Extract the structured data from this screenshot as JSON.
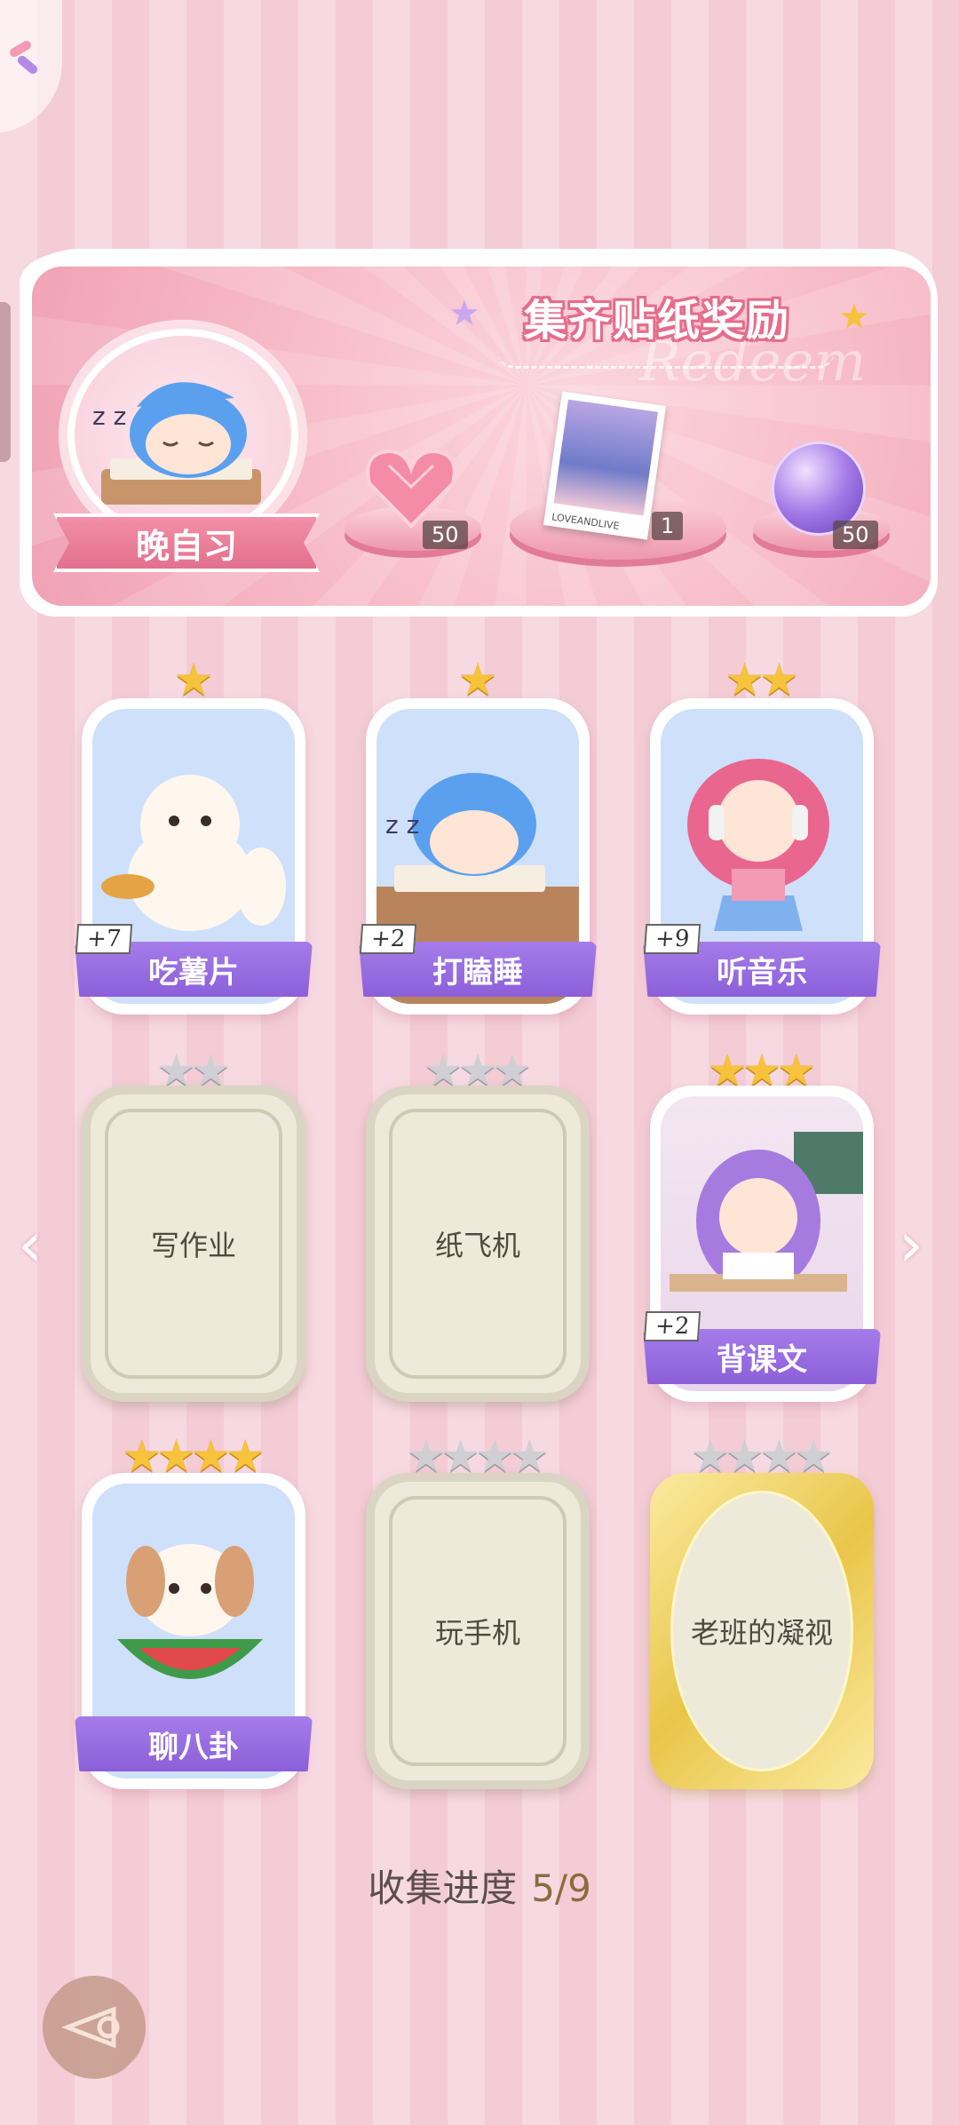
{
  "banner": {
    "title": "集齐贴纸奖励",
    "watermark": "Redeem",
    "theme_label": "晚自习",
    "rewards": [
      {
        "icon": "heart-gem-icon",
        "count": "50"
      },
      {
        "icon": "photo-card-icon",
        "count": "1",
        "caption": "LOVEANDLIVE"
      },
      {
        "icon": "purple-orb-icon",
        "count": "50"
      }
    ]
  },
  "stickers": [
    {
      "name": "吃薯片",
      "stars": 1,
      "collected": true,
      "plus": "+7"
    },
    {
      "name": "打瞌睡",
      "stars": 1,
      "collected": true,
      "plus": "+2"
    },
    {
      "name": "听音乐",
      "stars": 2,
      "collected": true,
      "plus": "+9"
    },
    {
      "name": "写作业",
      "stars": 2,
      "collected": false
    },
    {
      "name": "纸飞机",
      "stars": 3,
      "collected": false
    },
    {
      "name": "背课文",
      "stars": 3,
      "collected": true,
      "plus": "+2"
    },
    {
      "name": "聊八卦",
      "stars": 4,
      "collected": true
    },
    {
      "name": "玩手机",
      "stars": 4,
      "collected": false
    },
    {
      "name": "老班的凝视",
      "stars": 4,
      "collected": false,
      "golden": true
    }
  ],
  "progress": {
    "label": "收集进度",
    "value": "5/9"
  },
  "nav": {
    "prev": "‹",
    "next": "›"
  },
  "colors": {
    "accent_pink": "#e56d8c",
    "name_bar_purple": "#9a6fe2",
    "star_gold": "#f7c23c"
  }
}
